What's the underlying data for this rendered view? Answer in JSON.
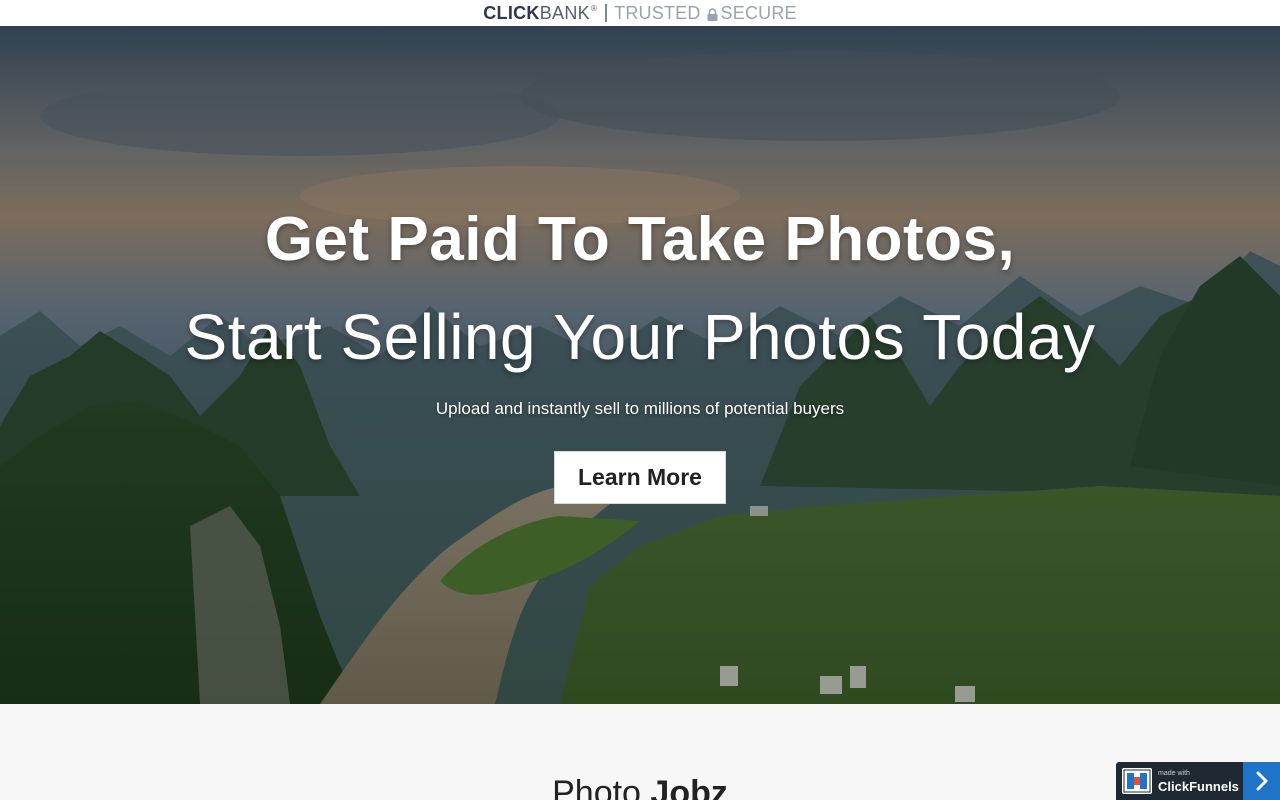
{
  "trust_bar": {
    "brand_bold": "CLICK",
    "brand_light": "BANK",
    "registered": "®",
    "trusted": "TRUSTED",
    "secure": "SECURE",
    "icons": [
      "lock-icon"
    ]
  },
  "hero": {
    "title": "Get Paid To Take Photos,",
    "subtitle": "Start Selling Your Photos Today",
    "tagline": "Upload and instantly sell to millions of potential buyers",
    "cta_label": "Learn More"
  },
  "section": {
    "title_light": "Photo",
    "title_bold": "Jobz"
  },
  "badge": {
    "made_with": "made with",
    "name": "ClickFunnels",
    "icons": [
      "clickfunnels-logo-icon",
      "chevron-right-icon"
    ]
  },
  "colors": {
    "badge_bg": "#1f2933",
    "badge_accent": "#1f74c7",
    "section_bg": "#f7f7f7",
    "button_bg": "#ffffff"
  }
}
